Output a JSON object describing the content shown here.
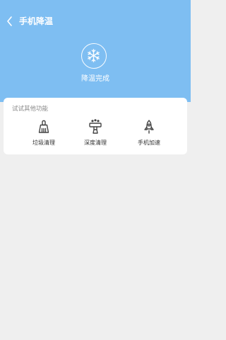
{
  "header": {
    "title": "手机降温",
    "back_icon": "chevron-left-icon",
    "status_icon": "snowflake-icon",
    "status_text": "降温完成",
    "background": "#7ebef2"
  },
  "card": {
    "title": "试试其他功能",
    "features": [
      {
        "label": "垃圾清理",
        "icon": "broom-icon"
      },
      {
        "label": "深度清理",
        "icon": "deep-clean-brush-icon"
      },
      {
        "label": "手机加速",
        "icon": "rocket-icon"
      }
    ]
  }
}
